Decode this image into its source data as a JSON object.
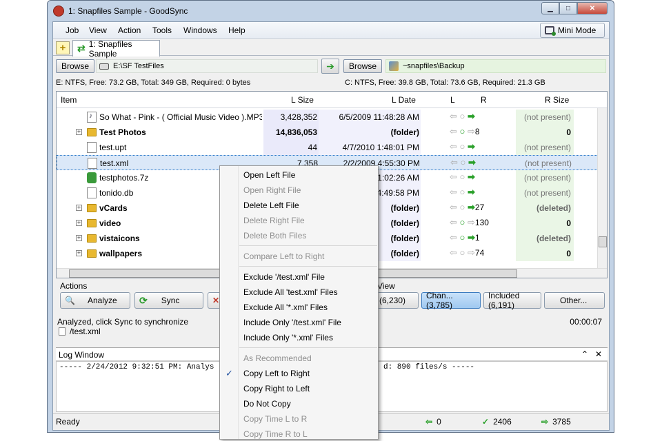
{
  "window": {
    "title": "1: Snapfiles Sample - GoodSync"
  },
  "menubar": {
    "items": [
      "Job",
      "View",
      "Action",
      "Tools",
      "Windows",
      "Help"
    ],
    "mini_mode": "Mini Mode"
  },
  "tabs": [
    {
      "label": "1: Snapfiles Sample"
    }
  ],
  "paths": {
    "browse_label": "Browse",
    "left_path": "E:\\SF TestFiles",
    "right_path": "~snapfiles\\Backup",
    "left_info": "E: NTFS, Free: 73.2 GB, Total: 349 GB, Required: 0 bytes",
    "right_info": "C: NTFS, Free: 39.8 GB, Total: 73.6 GB, Required: 21.3 GB"
  },
  "table": {
    "columns": {
      "item": "Item",
      "lsize": "L Size",
      "ldate": "L Date",
      "l": "L",
      "r": "R",
      "rsize": "R Size"
    },
    "rows": [
      {
        "name": "So What - Pink - ( Official Music Video ).MP3",
        "lsize": "3,428,352",
        "ldate": "6/5/2009 11:48:28 AM",
        "rsize": "(not present)",
        "count": ""
      },
      {
        "name": "Test Photos",
        "lsize": "14,836,053",
        "ldate": "(folder)",
        "rsize": "0",
        "count": "8"
      },
      {
        "name": "test.upt",
        "lsize": "44",
        "ldate": "4/7/2010 1:48:01 PM",
        "rsize": "(not present)",
        "count": ""
      },
      {
        "name": "test.xml",
        "lsize": "7,358",
        "ldate": "2/2/2009 4:55:30 PM",
        "rsize": "(not present)",
        "count": ""
      },
      {
        "name": "testphotos.7z",
        "lsize": "",
        "ldate": "1:02:26 AM",
        "rsize": "(not present)",
        "count": ""
      },
      {
        "name": "tonido.db",
        "lsize": "",
        "ldate": "4:49:58 PM",
        "rsize": "(not present)",
        "count": ""
      },
      {
        "name": "vCards",
        "lsize": "",
        "ldate": "(folder)",
        "rsize": "(deleted)",
        "count": "27"
      },
      {
        "name": "video",
        "lsize": "",
        "ldate": "(folder)",
        "rsize": "0",
        "count": "130"
      },
      {
        "name": "vistaicons",
        "lsize": "",
        "ldate": "(folder)",
        "rsize": "(deleted)",
        "count": "1"
      },
      {
        "name": "wallpapers",
        "lsize": "",
        "ldate": "(folder)",
        "rsize": "0",
        "count": "74"
      }
    ]
  },
  "actions": {
    "label": "Actions",
    "analyze": "Analyze",
    "sync": "Sync",
    "view_label": "View",
    "view_btn1": "(6,230)",
    "view_changed": "Chan... (3,785)",
    "view_included": "Included (6,191)",
    "view_other": "Other..."
  },
  "status": {
    "message": "Analyzed, click Sync to synchronize",
    "file": "/test.xml",
    "elapsed": "00:00:07"
  },
  "log": {
    "title": "Log Window",
    "line_left": "----- 2/24/2012 9:32:51 PM: Analys",
    "line_right": "d: 890 files/s -----"
  },
  "statusbar": {
    "ready": "Ready",
    "left_count": "0",
    "equal_count": "2406",
    "right_count": "3785"
  },
  "context_menu": {
    "items": [
      {
        "label": "Open Left File",
        "enabled": true
      },
      {
        "label": "Open Right File",
        "enabled": false
      },
      {
        "label": "Delete Left File",
        "enabled": true
      },
      {
        "label": "Delete Right File",
        "enabled": false
      },
      {
        "label": "Delete Both Files",
        "enabled": false
      },
      {
        "label": "Compare Left to Right",
        "enabled": false
      },
      {
        "label": "Exclude '/test.xml' File",
        "enabled": true
      },
      {
        "label": "Exclude All 'test.xml' Files",
        "enabled": true
      },
      {
        "label": "Exclude All '*.xml' Files",
        "enabled": true
      },
      {
        "label": "Include Only '/test.xml' File",
        "enabled": true
      },
      {
        "label": "Include Only '*.xml' Files",
        "enabled": true
      },
      {
        "label": "As Recommended",
        "enabled": false
      },
      {
        "label": "Copy Left to Right",
        "enabled": true,
        "checked": true
      },
      {
        "label": "Copy Right to Left",
        "enabled": true
      },
      {
        "label": "Do Not Copy",
        "enabled": true
      },
      {
        "label": "Copy Time L to R",
        "enabled": false
      },
      {
        "label": "Copy Time R to L",
        "enabled": false
      }
    ]
  }
}
